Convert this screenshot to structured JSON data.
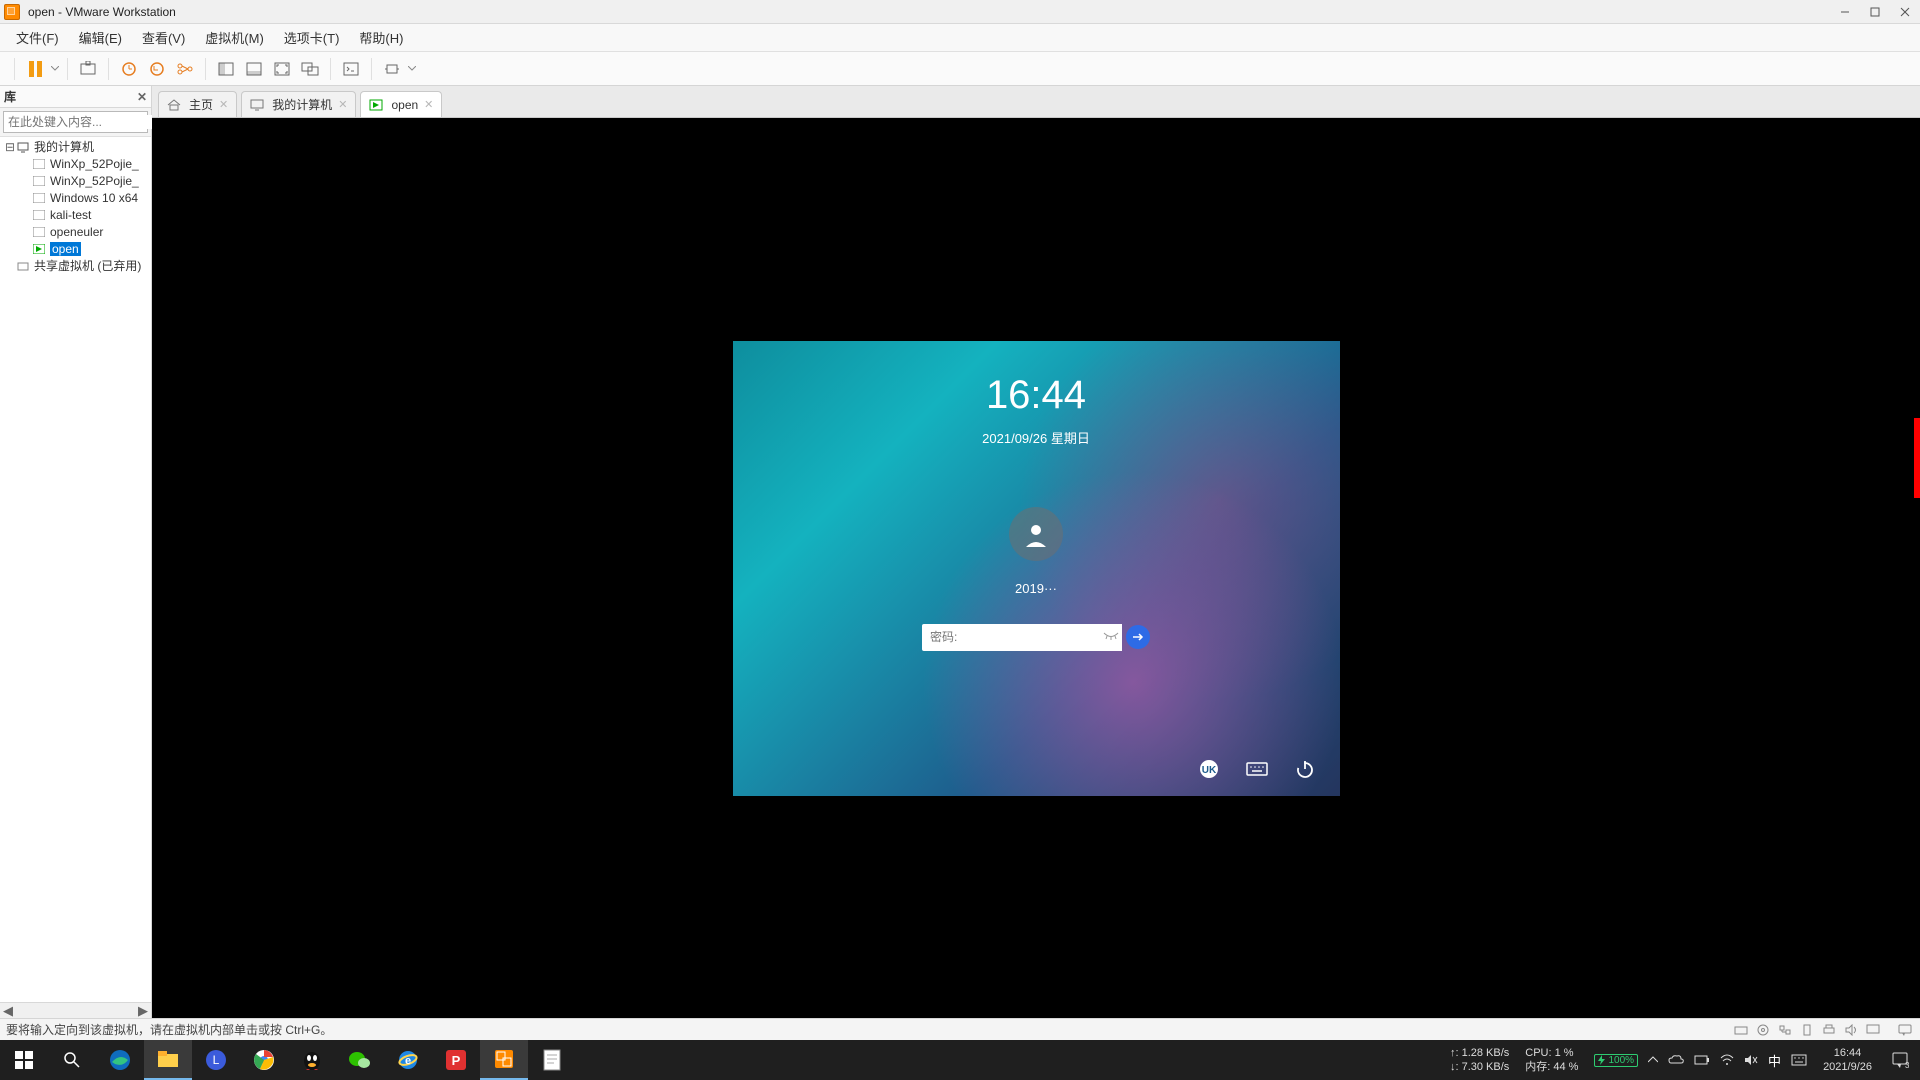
{
  "title": "open - VMware Workstation",
  "menu": [
    "文件(F)",
    "编辑(E)",
    "查看(V)",
    "虚拟机(M)",
    "选项卡(T)",
    "帮助(H)"
  ],
  "library": {
    "title": "库",
    "search_placeholder": "在此处键入内容...",
    "root": "我的计算机",
    "vms": [
      "WinXp_52Pojie_",
      "WinXp_52Pojie_",
      "Windows 10 x64",
      "kali-test",
      "openeuler",
      "open"
    ],
    "selected": "open",
    "shared": "共享虚拟机 (已弃用)"
  },
  "tabs": {
    "home": "主页",
    "mycomputer": "我的计算机",
    "open": "open"
  },
  "login": {
    "time": "16:44",
    "date": "2021/09/26 星期日",
    "user": "2019···",
    "password_placeholder": "密码:"
  },
  "statusbar": {
    "msg": "要将输入定向到该虚拟机，请在虚拟机内部单击或按 Ctrl+G。"
  },
  "host": {
    "net_up": "↑: 1.28 KB/s",
    "net_down": "↓: 7.30 KB/s",
    "cpu": "CPU: 1 %",
    "mem": "内存: 44 %",
    "battery": "100%",
    "ime": "中",
    "clock_time": "16:44",
    "clock_date": "2021/9/26"
  }
}
